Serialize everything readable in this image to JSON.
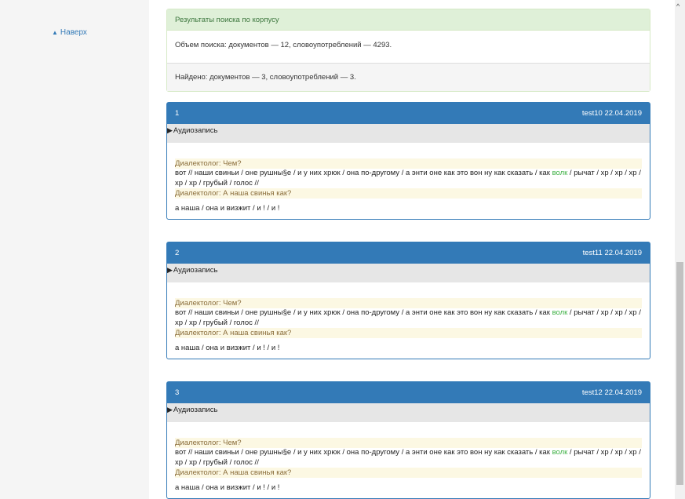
{
  "sidebar": {
    "to_top_icon": "▲",
    "to_top_label": "Наверх"
  },
  "search": {
    "header": "Результаты поиска по корпусу",
    "volume": "Объем поиска: документов — 12, словоупотреблений — 4293.",
    "found": "Найдено: документов — 3, словоупотреблений — 3."
  },
  "results": [
    {
      "num": "1",
      "meta": "test10 22.04.2019",
      "audio": "Аудиозапись",
      "q1": "Диалектолог: Чем?",
      "text_before": "вот // наши свиньи / оне рушны§е / и у них хрюк / она по-другому / а энти оне как это вон ну как сказать / как ",
      "hit": "волк",
      "text_after": " / рычат / хр / хр / хр / хр / хр / грубый / голос //",
      "q2": "Диалектолог: А наша свинья как?",
      "answer": "а наша / она и визжит / и ! / и !"
    },
    {
      "num": "2",
      "meta": "test11 22.04.2019",
      "audio": "Аудиозапись",
      "q1": "Диалектолог: Чем?",
      "text_before": "вот // наши свиньи / оне рушны§е / и у них хрюк / она по-другому / а энти оне как это вон ну как сказать / как ",
      "hit": "волк",
      "text_after": " / рычат / хр / хр / хр / хр / хр / грубый / голос //",
      "q2": "Диалектолог: А наша свинья как?",
      "answer": "а наша / она и визжит / и ! / и !"
    },
    {
      "num": "3",
      "meta": "test12 22.04.2019",
      "audio": "Аудиозапись",
      "q1": "Диалектолог: Чем?",
      "text_before": "вот // наши свиньи / оне рушны§е / и у них хрюк / она по-другому / а энти оне как это вон ну как сказать / как ",
      "hit": "волк",
      "text_after": " / рычат / хр / хр / хр / хр / хр / грубый / голос //",
      "q2": "Диалектолог: А наша свинья как?",
      "answer": "а наша / она и визжит / и ! / и !"
    }
  ],
  "scrollbar": {
    "up_icon": "^"
  },
  "colors": {
    "primary": "#337ab7",
    "success_bg": "#dff0d8",
    "highlight": "#3cb043",
    "speaker_bg": "#fcf8e3"
  }
}
